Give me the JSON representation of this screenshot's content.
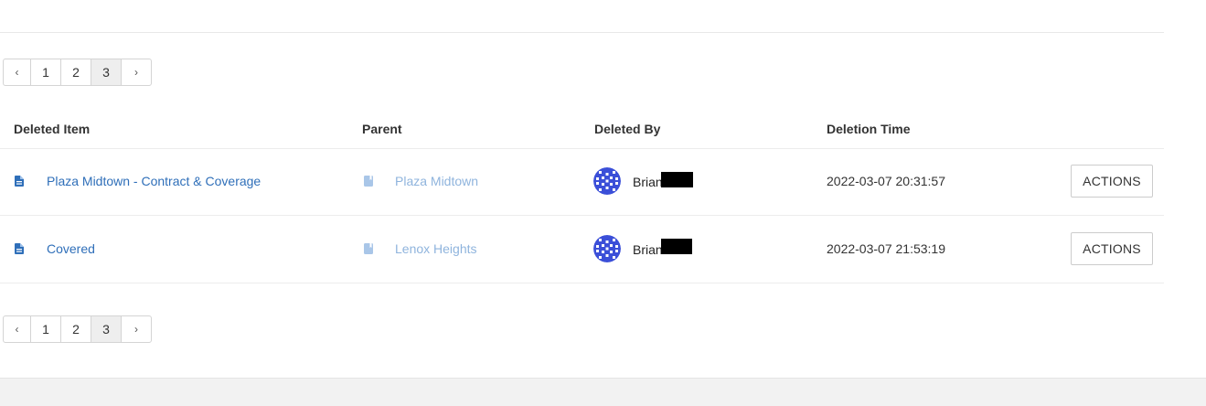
{
  "pagination": {
    "prev": "‹",
    "next": "›",
    "pages": [
      "1",
      "2",
      "3"
    ],
    "active_page": "3"
  },
  "table": {
    "columns": [
      "Deleted Item",
      "Parent",
      "Deleted By",
      "Deletion Time"
    ],
    "rows": [
      {
        "item": "Plaza Midtown - Contract & Coverage",
        "parent": "Plaza Midtown",
        "deleted_by": "Brian",
        "deletion_time": "2022-03-07 20:31:57",
        "action_label": "ACTIONS"
      },
      {
        "item": "Covered",
        "parent": "Lenox Heights",
        "deleted_by": "Brian",
        "deletion_time": "2022-03-07 21:53:19",
        "action_label": "ACTIONS"
      }
    ]
  },
  "icons": {
    "item": "document-icon",
    "parent": "book-icon",
    "user": "avatar"
  },
  "colors": {
    "link": "#2f6fb9",
    "parent_link": "#8fb4dd",
    "avatar": "#3b4fd8"
  }
}
